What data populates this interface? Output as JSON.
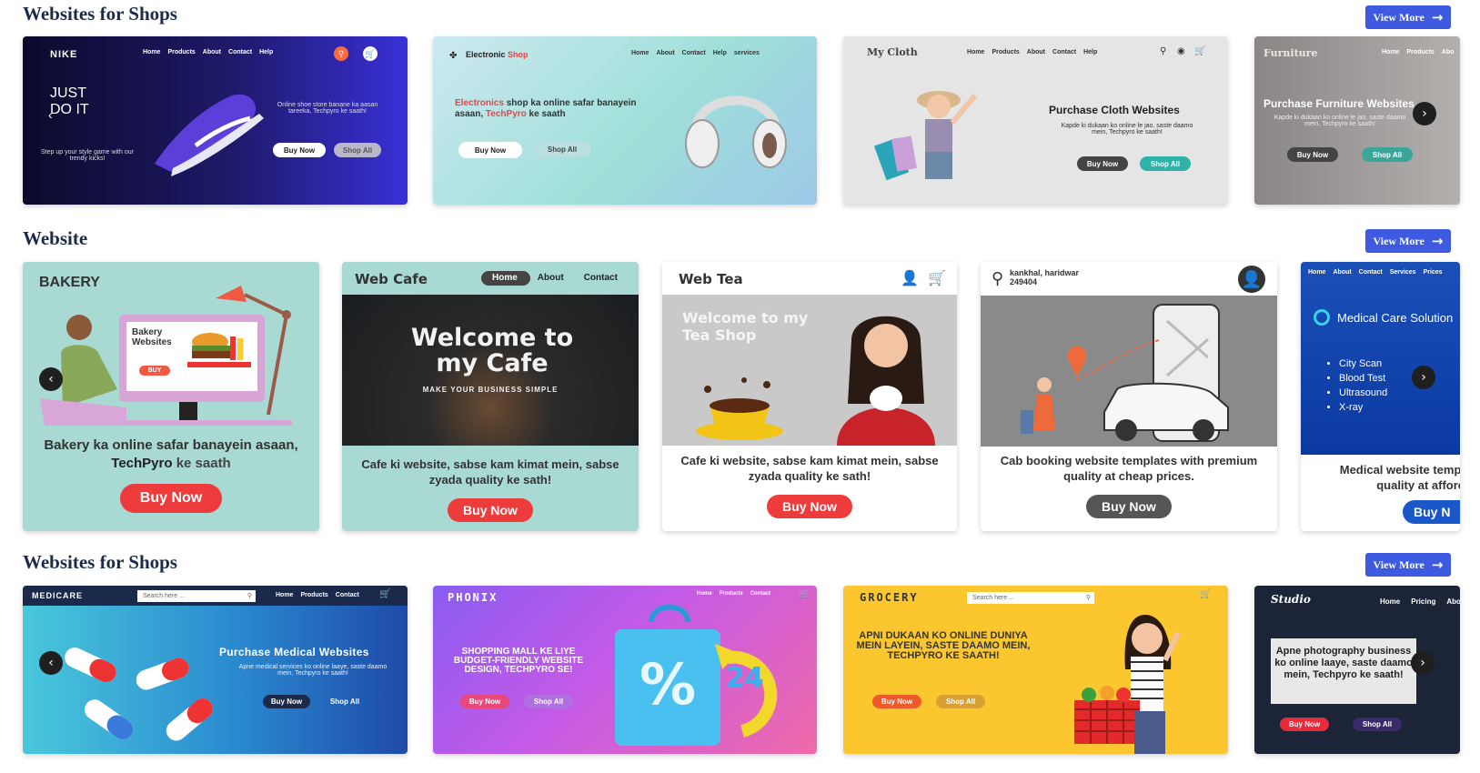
{
  "sections": [
    {
      "title": "Websites for Shops",
      "view_more": "View More"
    },
    {
      "title": "Website",
      "view_more": "View More"
    },
    {
      "title": "Websites for Shops",
      "view_more": "View More"
    }
  ],
  "row1": {
    "nike": {
      "brand": "NIKE",
      "nav": [
        "Home",
        "Products",
        "About",
        "Contact",
        "Help"
      ],
      "hero": "JUST DO IT",
      "tag": "Step up your style game with our trendy kicks!",
      "desc": "Online shoe store banane ka aasan tareeka, Techpyro ke saath!",
      "buy": "Buy Now",
      "shop": "Shop All"
    },
    "electronic": {
      "brand_a": "Electronic",
      "brand_b": "Shop",
      "nav": [
        "Home",
        "About",
        "Contact",
        "Help",
        "services"
      ],
      "hl_a": "Electronics",
      "line1": "shop ka online safar",
      "line2": "banayein asaan,",
      "hl_b": "TechPyro",
      "line3": "ke saath",
      "buy": "Buy Now",
      "shop": "Shop All"
    },
    "cloth": {
      "brand": "My Cloth",
      "nav": [
        "Home",
        "Products",
        "About",
        "Contact",
        "Help"
      ],
      "title": "Purchase Cloth Websites",
      "desc": "Kapde ki dukaan ko online le jao, saste daamo mein, Techpyro ke saath!",
      "buy": "Buy Now",
      "shop": "Shop All"
    },
    "furniture": {
      "brand": "Furniture",
      "nav": [
        "Home",
        "Products",
        "Abo"
      ],
      "title": "Purchase Furniture Websites",
      "desc": "Kapde ki dukaan ko online le jao, saste daamo mein, Techpyro ke saath!",
      "buy": "Buy Now",
      "shop": "Shop All"
    }
  },
  "row2": {
    "bakery": {
      "brand": "BAKERY",
      "screen": "Bakery Websites",
      "screen_buy": "BUY",
      "caption_a": "Bakery ka online safar banayein asaan,",
      "caption_b": "TechPyro",
      "caption_c": "ke saath",
      "buy": "Buy Now"
    },
    "cafe": {
      "brand": "Web Cafe",
      "nav": [
        "Home",
        "About",
        "Contact"
      ],
      "hero": "Welcome to my Cafe",
      "sub": "MAKE YOUR BUSINESS SIMPLE",
      "caption": "Cafe ki website, sabse kam kimat mein, sabse zyada quality ke sath!",
      "buy": "Buy Now"
    },
    "tea": {
      "brand": "Web Tea",
      "hero": "Welcome to my Tea Shop",
      "caption": "Cafe ki website, sabse kam kimat mein, sabse zyada quality ke sath!",
      "buy": "Buy Now"
    },
    "cab": {
      "addr1": "kankhal, haridwar",
      "addr2": "249404",
      "caption": "Cab booking website templates with premium quality at cheap prices.",
      "buy": "Buy Now"
    },
    "medical": {
      "nav": [
        "Home",
        "About",
        "Contact",
        "Services",
        "Prices"
      ],
      "title": "Medical Care Solution",
      "items": [
        "City Scan",
        "Blood Test",
        "Ultrasound",
        "X-ray"
      ],
      "caption": "Medical website templ quality at afforc",
      "buy": "Buy N"
    }
  },
  "row3": {
    "medicare": {
      "brand": "MEDICARE",
      "search": "Search here ...",
      "nav": [
        "Home",
        "Products",
        "Contact"
      ],
      "title": "Purchase Medical Websites",
      "desc": "Apne medical services ko online laaye, saste daamo mein, Techpyro ke saath!",
      "buy": "Buy Now",
      "shop": "Shop All"
    },
    "phonix": {
      "brand": "PHONIX",
      "nav": [
        "Home",
        "Products",
        "Contact"
      ],
      "text": "SHOPPING MALL KE LIYE BUDGET-FRIENDLY WEBSITE DESIGN, TECHPYRO SE!",
      "buy": "Buy Now",
      "shop": "Shop All",
      "badge": "24"
    },
    "grocery": {
      "brand": "GROCERY",
      "search": "Search here ...",
      "text": "APNI DUKAAN KO ONLINE DUNIYA MEIN LAYEIN, SASTE DAAMO MEIN, TECHPYRO KE SAATH!",
      "buy": "Buy Now",
      "shop": "Shop All"
    },
    "studio": {
      "brand": "Studio",
      "nav": [
        "Home",
        "Pricing",
        "Abo"
      ],
      "text": "Apne photography business ko online laaye, saste daamo mein, Techpyro ke saath!",
      "buy": "Buy Now",
      "shop": "Shop All"
    }
  },
  "colors": {
    "accent": "#3d5ae0",
    "title": "#1c2b4a",
    "buy_red": "#ee3b3b"
  }
}
